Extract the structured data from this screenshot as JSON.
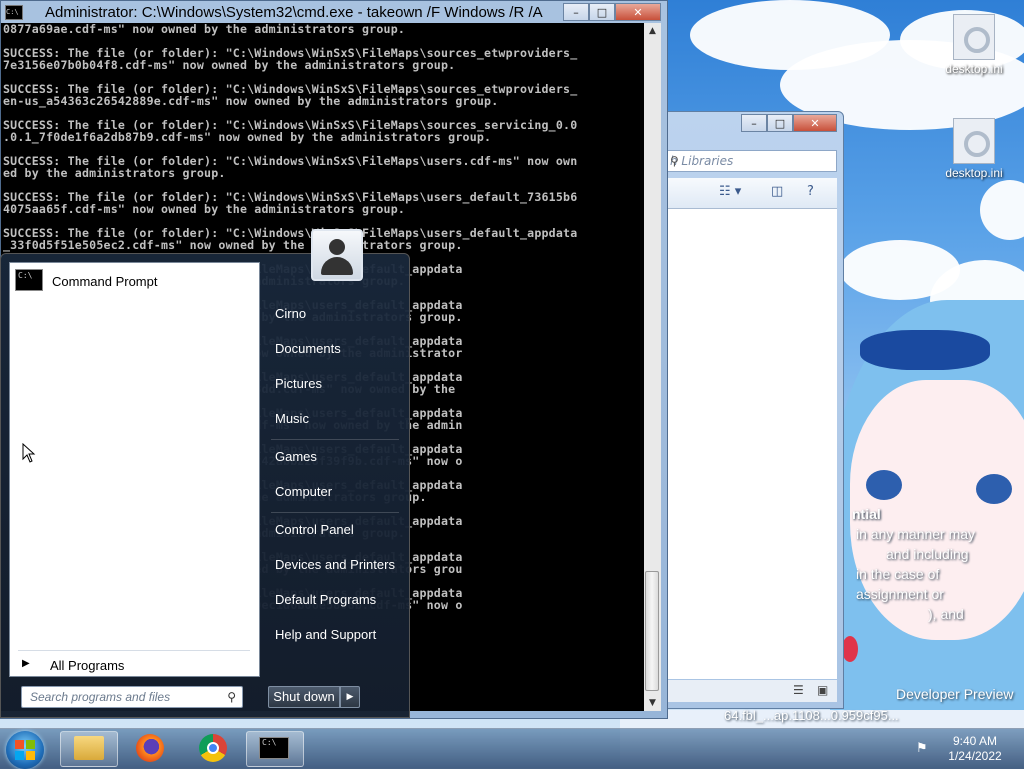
{
  "cmd_window": {
    "title": "Administrator: C:\\Windows\\System32\\cmd.exe - takeown  /F Windows /R /A",
    "controls": {
      "minimize": "–",
      "maximize": "□",
      "close": "✕"
    },
    "icon_text": "C:\\",
    "console_lines": [
      "0877a69ae.cdf-ms\" now owned by the administrators group.",
      "",
      "SUCCESS: The file (or folder): \"C:\\Windows\\WinSxS\\FileMaps\\sources_etwproviders_",
      "7e3156e07b0b04f8.cdf-ms\" now owned by the administrators group.",
      "",
      "SUCCESS: The file (or folder): \"C:\\Windows\\WinSxS\\FileMaps\\sources_etwproviders_",
      "en-us_a54363c26542889e.cdf-ms\" now owned by the administrators group.",
      "",
      "SUCCESS: The file (or folder): \"C:\\Windows\\WinSxS\\FileMaps\\sources_servicing_0.0",
      ".0.1_7f0de1f6a2db87b9.cdf-ms\" now owned by the administrators group.",
      "",
      "SUCCESS: The file (or folder): \"C:\\Windows\\WinSxS\\FileMaps\\users.cdf-ms\" now own",
      "ed by the administrators group.",
      "",
      "SUCCESS: The file (or folder): \"C:\\Windows\\WinSxS\\FileMaps\\users_default_73615b6",
      "4075aa65f.cdf-ms\" now owned by the administrators group.",
      "",
      "SUCCESS: The file (or folder): \"C:\\Windows\\WinSxS\\FileMaps\\users_default_appdata",
      "_33f0d5f51e505ec2.cdf-ms\" now owned by the administrators group.",
      "",
      "                                   ileMaps\\users_default_appdata",
      "                                   administrators group.",
      "",
      "                                   ileMaps\\users_default_appdata",
      "                                    by the administrators group.",
      "",
      "                                   ileMaps\\users_default_appdata",
      "                                   ow owned by the administrator",
      "",
      "                                   ileMaps\\users_default_appdata",
      "                                   8dd.cdf-ms\" now owned by the",
      "",
      "                                   ileMaps\\users_default_appdata",
      "                                   df-ms\" now owned by the admin",
      "",
      "                                   ileMaps\\users_default_appdata",
      "                                   242abb228f39f9b.cdf-ms\" now o",
      "",
      "                                   ileMaps\\users_default_appdata",
      "                                   he administrators group.",
      "",
      "                                   ileMaps\\users_default_appdata",
      "                                   administrators group.",
      "",
      "                                   ileMaps\\users_default_appdata",
      "                                   ed by the administrators grou",
      "",
      "                                   ileMaps\\users_default_appdata",
      "                                   0ec1d6b06e5808b.cdf-ms\" now o"
    ]
  },
  "explorer_window": {
    "controls": {
      "minimize": "–",
      "maximize": "□",
      "close": "✕"
    },
    "search_placeholder": "h Libraries",
    "toolbar_icons": [
      "view-options-icon",
      "preview-pane-icon",
      "help-icon"
    ],
    "status_icons": [
      "details-view-icon",
      "large-icons-view-icon"
    ]
  },
  "start_menu": {
    "pinned_program": "Command Prompt",
    "pinned_icon_text": "C:\\",
    "all_programs": "All Programs",
    "search_placeholder": "Search programs and files",
    "right_items": [
      "Cirno",
      "Documents",
      "Pictures",
      "Music",
      "Games",
      "Computer",
      "Control Panel",
      "Devices and Printers",
      "Default Programs",
      "Help and Support"
    ],
    "shutdown_label": "Shut down",
    "shutdown_arrow": "▶"
  },
  "desktop": {
    "icons": [
      {
        "label": "desktop.ini"
      },
      {
        "label": "desktop.ini"
      }
    ],
    "watermark": {
      "title": "ntial",
      "lines": [
        "in any manner may",
        "and including",
        "in the case of",
        "assignment or",
        "), and"
      ],
      "build": "Developer Preview",
      "build_line": "64.fbl_...ap.1108...0.959cf95..."
    }
  },
  "taskbar": {
    "tray_icon": "network-icon",
    "time": "9:40 AM",
    "date": "1/24/2022",
    "cmd_icon_text": "C:\\"
  }
}
